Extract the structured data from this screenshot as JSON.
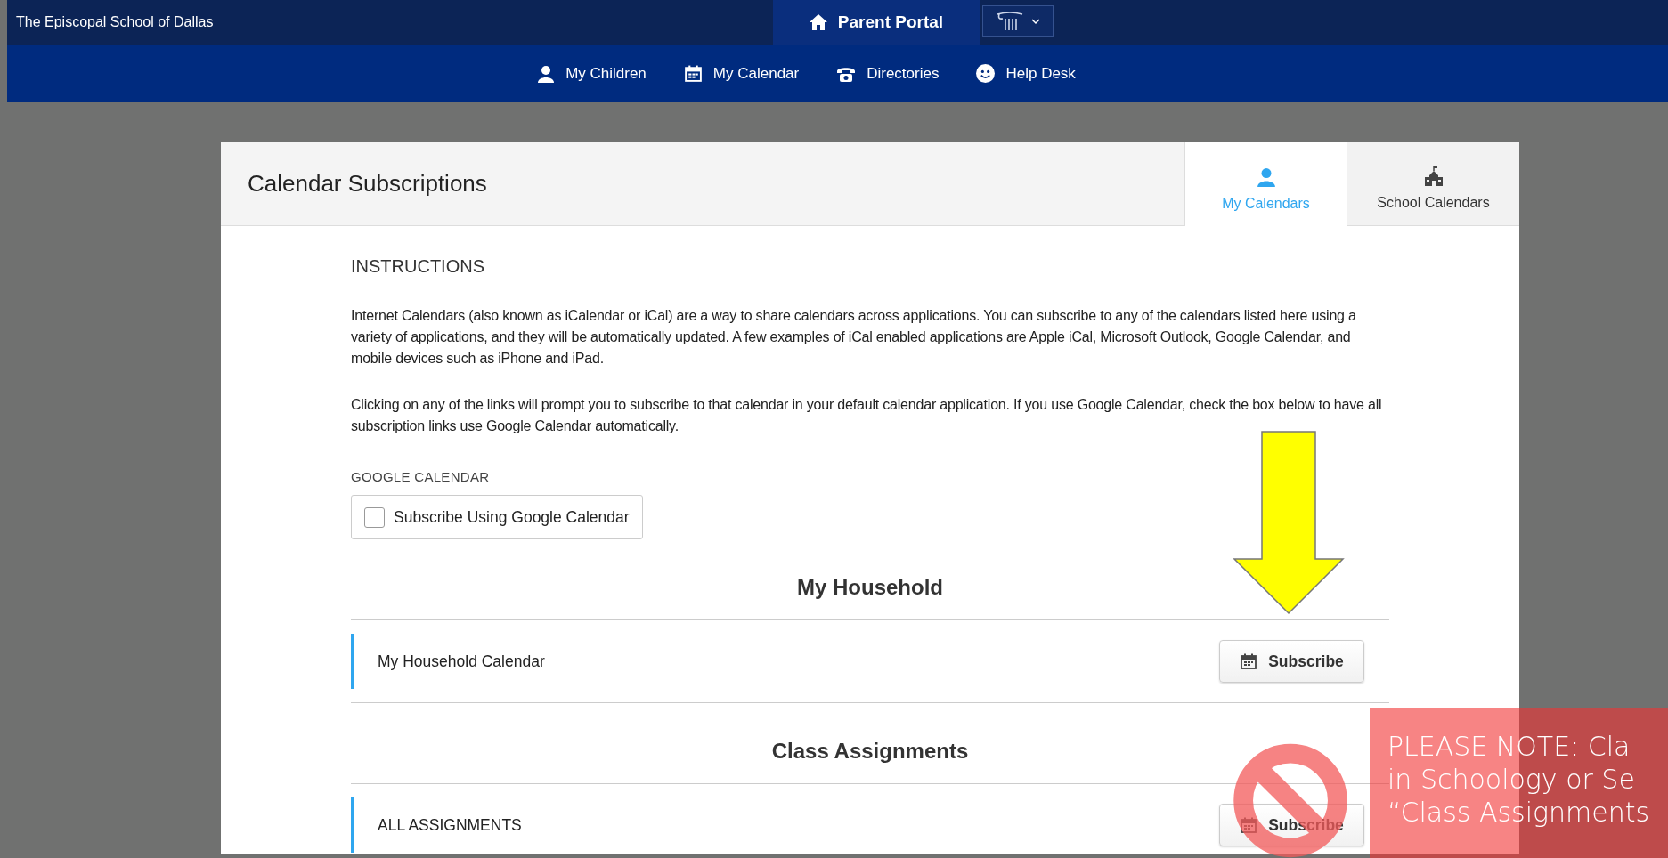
{
  "top_bar": {
    "school": "The Episcopal School of Dallas",
    "portal": "Parent Portal"
  },
  "nav": [
    {
      "label": "My Children"
    },
    {
      "label": "My Calendar"
    },
    {
      "label": "Directories"
    },
    {
      "label": "Help Desk"
    }
  ],
  "card": {
    "title": "Calendar Subscriptions",
    "tabs": [
      {
        "label": "My Calendars",
        "selected": true
      },
      {
        "label": "School Calendars",
        "selected": false
      }
    ],
    "instructions_heading": "INSTRUCTIONS",
    "paragraphs": [
      "Internet Calendars (also known as iCalendar or iCal) are a way to share calendars across applications. You can subscribe to any of the calendars listed here using a variety of applications, and they will be automatically updated. A few examples of iCal enabled applications are Apple iCal, Microsoft Outlook, Google Calendar, and mobile devices such as iPhone and iPad.",
      "Clicking on any of the links will prompt you to subscribe to that calendar in your default calendar application. If you use Google Calendar, check the box below to have all subscription links use Google Calendar automatically."
    ],
    "google_label": "GOOGLE CALENDAR",
    "google_checkbox": {
      "label": "Subscribe Using Google Calendar",
      "checked": false
    },
    "sections": [
      {
        "heading": "My Household",
        "rows": [
          {
            "name": "My Household Calendar",
            "button": "Subscribe"
          }
        ]
      },
      {
        "heading": "Class Assignments",
        "rows": [
          {
            "name": "ALL ASSIGNMENTS",
            "button": "Subscribe"
          }
        ]
      }
    ]
  },
  "annotations": {
    "note_lines": [
      "PLEASE NOTE: Cla",
      "in Schoology or Se",
      "“Class Assignments"
    ]
  }
}
